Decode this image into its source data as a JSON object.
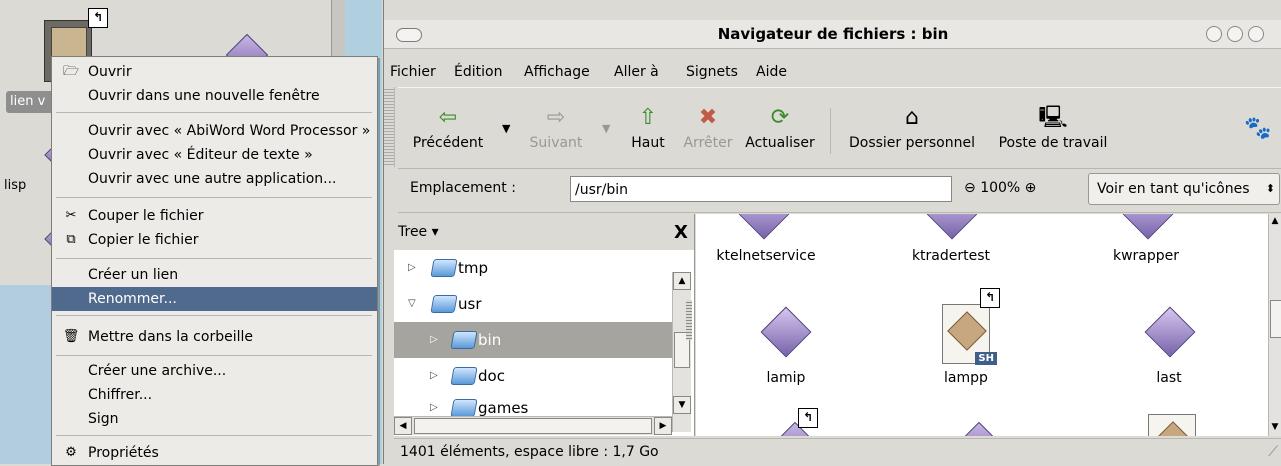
{
  "desktop": {
    "icon1_label": "lien v",
    "icon2_label": "lisp",
    "link_glyph": "↰"
  },
  "context_menu": {
    "items": [
      {
        "icon": "🗁",
        "label": "Ouvrir"
      },
      {
        "icon": "",
        "label": "Ouvrir dans une nouvelle fenêtre"
      },
      {
        "icon": "",
        "label": "Ouvrir avec « AbiWord Word Processor »"
      },
      {
        "icon": "",
        "label": "Ouvrir avec « Éditeur de texte »"
      },
      {
        "icon": "",
        "label": "Ouvrir avec une autre application..."
      },
      {
        "icon": "✂",
        "label": "Couper le fichier"
      },
      {
        "icon": "⧉",
        "label": "Copier le fichier"
      },
      {
        "icon": "",
        "label": "Créer un lien"
      },
      {
        "icon": "",
        "label": "Renommer..."
      },
      {
        "icon": "🗑",
        "label": "Mettre dans la corbeille"
      },
      {
        "icon": "",
        "label": "Créer une archive..."
      },
      {
        "icon": "",
        "label": "Chiffrer..."
      },
      {
        "icon": "",
        "label": "Sign"
      },
      {
        "icon": "⚙",
        "label": "Propriétés"
      }
    ],
    "selected": "Renommer..."
  },
  "window": {
    "title": "Navigateur de fichiers : bin",
    "menu": [
      "Fichier",
      "Édition",
      "Affichage",
      "Aller à",
      "Signets",
      "Aide"
    ],
    "toolbar": {
      "back": {
        "label": "Précédent",
        "icon": "⇦"
      },
      "forward": {
        "label": "Suivant",
        "icon": "⇨"
      },
      "up": {
        "label": "Haut",
        "icon": "⇧"
      },
      "stop": {
        "label": "Arrêter",
        "icon": "✖"
      },
      "reload": {
        "label": "Actualiser",
        "icon": "⟳"
      },
      "home": {
        "label": "Dossier personnel",
        "icon": "⌂"
      },
      "computer": {
        "label": "Poste de travail",
        "icon": "🖳"
      },
      "gnome_icon": "🐾"
    },
    "location": {
      "label": "Emplacement :",
      "value": "/usr/bin",
      "zoom": "100%",
      "view_mode": "Voir en tant qu'icônes"
    },
    "tree": {
      "title": "Tree ▾",
      "close": "X",
      "rows": [
        {
          "name": "tmp",
          "expander": "▷"
        },
        {
          "name": "usr",
          "expander": "▽"
        },
        {
          "name": "bin",
          "expander": "▷"
        },
        {
          "name": "doc",
          "expander": "▷"
        },
        {
          "name": "games",
          "expander": "▷"
        }
      ],
      "selected": "bin"
    },
    "files": [
      {
        "name": "ktelnetservice"
      },
      {
        "name": "ktradertest"
      },
      {
        "name": "kwrapper"
      },
      {
        "name": "lamip"
      },
      {
        "name": "lampp",
        "badge": "SH"
      },
      {
        "name": "last"
      }
    ],
    "status": "1401 éléments, espace libre : 1,7 Go"
  }
}
